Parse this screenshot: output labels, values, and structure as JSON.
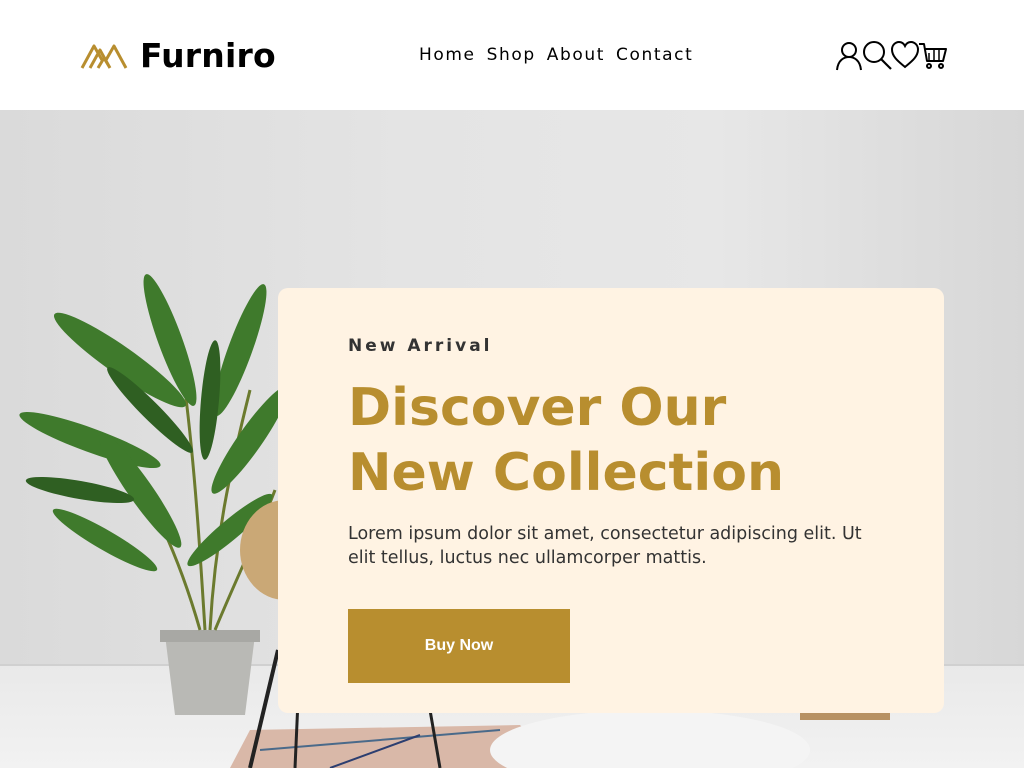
{
  "brand": {
    "name": "Furniro",
    "logo_icon": "furniro-logo-icon",
    "accent": "#b88e2f"
  },
  "nav": [
    {
      "label": "Home"
    },
    {
      "label": "Shop"
    },
    {
      "label": "About"
    },
    {
      "label": "Contact"
    }
  ],
  "header_icons": [
    {
      "icon": "account-icon"
    },
    {
      "icon": "search-icon"
    },
    {
      "icon": "heart-icon"
    },
    {
      "icon": "cart-icon"
    }
  ],
  "hero": {
    "eyebrow": "New Arrival",
    "headline_line1": "Discover Our",
    "headline_line2": "New Collection",
    "description": "Lorem ipsum dolor sit amet, consectetur adipiscing elit. Ut elit tellus, luctus nec ullamcorper mattis.",
    "cta_label": "Buy Now",
    "card_color": "#fff3e3",
    "button_color": "#b88e2f"
  }
}
